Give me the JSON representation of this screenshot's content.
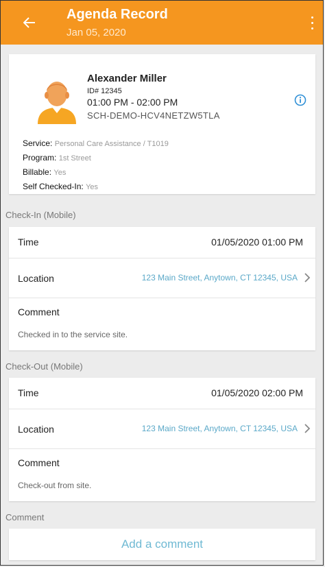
{
  "header": {
    "title": "Agenda Record",
    "date": "Jan 05, 2020",
    "back_icon": "arrow-left-icon",
    "menu_icon": "more-vert-icon",
    "color": "#f5961f"
  },
  "profile": {
    "name": "Alexander Miller",
    "id_label": "ID# 12345",
    "time_range": "01:00 PM - 02:00 PM",
    "schedule_code": "SCH-DEMO-HCV4NETZW5TLA",
    "service_label": "Service:",
    "service_value": "Personal Care Assistance / T1019",
    "program_label": "Program:",
    "program_value": "1st Street",
    "billable_label": "Billable:",
    "billable_value": "Yes",
    "self_checked_label": "Self Checked-In:",
    "self_checked_value": "Yes",
    "info_icon": "info-icon"
  },
  "checkin": {
    "section_title": "Check-In (Mobile)",
    "time_label": "Time",
    "time_value": "01/05/2020 01:00 PM",
    "location_label": "Location",
    "location_value": "123 Main Street, Anytown, CT 12345, USA",
    "comment_label": "Comment",
    "comment_value": "Checked in to the service site."
  },
  "checkout": {
    "section_title": "Check-Out (Mobile)",
    "time_label": "Time",
    "time_value": "01/05/2020 02:00 PM",
    "location_label": "Location",
    "location_value": "123 Main Street, Anytown, CT 12345, USA",
    "comment_label": "Comment",
    "comment_value": "Check-out from site."
  },
  "comment_section": {
    "title": "Comment",
    "add_button": "Add a comment"
  }
}
